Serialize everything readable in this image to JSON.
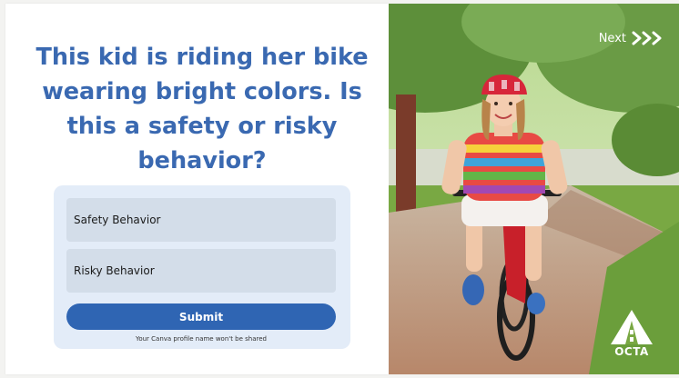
{
  "question": {
    "text": "This kid is riding her bike wearing bright colors. Is this a safety or risky behavior?"
  },
  "options": [
    {
      "label": "Safety Behavior"
    },
    {
      "label": "Risky Behavior"
    }
  ],
  "submit_label": "Submit",
  "privacy_note": "Your Canva profile name won't be shared",
  "nav": {
    "next_label": "Next",
    "next_icon": "triple-chevron-right-icon"
  },
  "logo": {
    "text": "OCTA"
  },
  "colors": {
    "question_text": "#3a69b1",
    "card_bg": "#e3ecf8",
    "option_bg": "#d3dde9",
    "submit_bg": "#2f65b3"
  }
}
